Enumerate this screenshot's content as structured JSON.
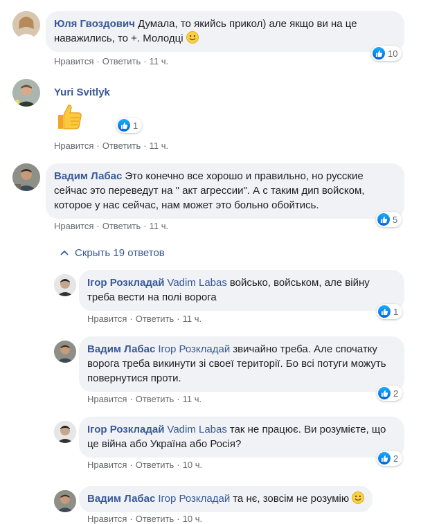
{
  "comments": [
    {
      "author": "Юля Гвоздович",
      "text": "Думала, то якийсь прикол) але якщо ви на це наважились, то +. Молодці",
      "emoji": "smile-emoji",
      "like_label": "Нравится",
      "reply_label": "Ответить",
      "time": "11 ч.",
      "reactions": "10"
    },
    {
      "author": "Yuri Svitlyk",
      "sticker": "thumbs-up-sticker",
      "like_label": "Нравится",
      "reply_label": "Ответить",
      "time": "11 ч.",
      "reactions": "1"
    },
    {
      "author": "Вадим Лабас",
      "text": "Это конечно все хорошо и правильно, но русские сейчас это переведут на \" акт агрессии\". А с таким дип войском, которое у нас сейчас, нам может это больно обойтись.",
      "like_label": "Нравится",
      "reply_label": "Ответить",
      "time": "11 ч.",
      "reactions": "5"
    }
  ],
  "replies_toggle": "Скрыть 19 ответов",
  "replies": [
    {
      "author": "Ігор Розкладай",
      "mention": "Vadim Labas",
      "text": "войсько, войськом, але війну треба вести на полі ворога",
      "like_label": "Нравится",
      "reply_label": "Ответить",
      "time": "11 ч.",
      "reactions": "1"
    },
    {
      "author": "Вадим Лабас",
      "mention": "Ігор Розкладай",
      "text": "звичайно треба. Але спочатку ворога треба викинути зі своеї території. Бо всі потуги можуть повернутися проти.",
      "like_label": "Нравится",
      "reply_label": "Ответить",
      "time": "11 ч.",
      "reactions": "2"
    },
    {
      "author": "Ігор Розкладай",
      "mention": "Vadim Labas",
      "text": "так не працює. Ви розумієте, що це війна або Україна або Росія?",
      "like_label": "Нравится",
      "reply_label": "Ответить",
      "time": "10 ч.",
      "reactions": "2"
    },
    {
      "author": "Вадим Лабас",
      "mention": "Ігор Розкладай",
      "text": "та нє, зовсім не розумію",
      "emoji": "smile-emoji",
      "like_label": "Нравится",
      "reply_label": "Ответить",
      "time": "10 ч."
    }
  ],
  "colors": {
    "name": "#385898",
    "bubble": "#f0f2f5",
    "meta": "#65676b",
    "like": "#0062df"
  }
}
